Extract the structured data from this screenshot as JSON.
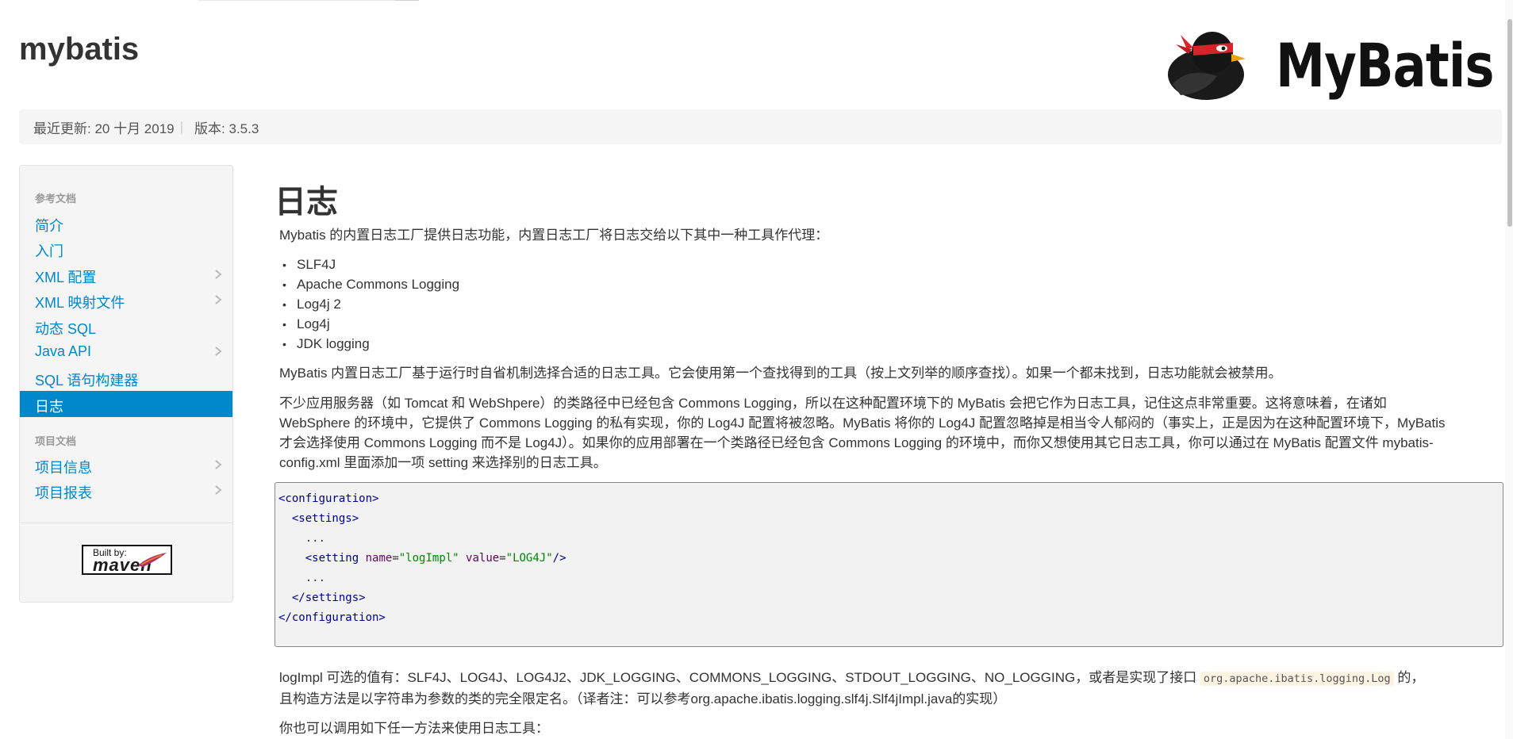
{
  "header": {
    "brand": "mybatis",
    "logo_alt": "MyBatis"
  },
  "breadcrumb": {
    "last_updated": "最近更新: 20 十月 2019",
    "separator": "|",
    "version": "版本: 3.5.3"
  },
  "sidebar": {
    "sections": [
      {
        "header": "参考文档",
        "items": [
          "简介",
          "入门",
          "XML 配置",
          "XML 映射文件",
          "动态 SQL",
          "Java API",
          "SQL 语句构建器",
          "日志"
        ]
      },
      {
        "header": "项目文档",
        "items": [
          "项目信息",
          "项目报表"
        ]
      }
    ],
    "active_item": "日志",
    "built_by": "Built by:",
    "maven": "maven"
  },
  "content": {
    "title": "日志",
    "intro": "Mybatis 的内置日志工厂提供日志功能，内置日志工厂将日志交给以下其中一种工具作代理：",
    "tools": [
      "SLF4J",
      "Apache Commons Logging",
      "Log4j 2",
      "Log4j",
      "JDK logging"
    ],
    "para1": "MyBatis 内置日志工厂基于运行时自省机制选择合适的日志工具。它会使用第一个查找得到的工具（按上文列举的顺序查找）。如果一个都未找到，日志功能就会被禁用。",
    "para2_lines": [
      "不少应用服务器（如 Tomcat 和 WebShpere）的类路径中已经包含 Commons Logging，所以在这种配置环境下的 MyBatis 会把它作为日志工具，记住这点非常重要。这将意味着，在诸如",
      "WebSphere 的环境中，它提供了 Commons Logging 的私有实现，你的 Log4J 配置将被忽略。MyBatis 将你的 Log4J 配置忽略掉是相当令人郁闷的（事实上，正是因为在这种配置环境下，MyBatis",
      "才会选择使用 Commons Logging 而不是 Log4J）。如果你的应用部署在一个类路径已经包含 Commons Logging 的环境中，而你又想使用其它日志工具，你可以通过在 MyBatis 配置文件 mybatis-",
      "config.xml 里面添加一项 setting 来选择别的日志工具。"
    ],
    "code": {
      "configuration_open": "<configuration>",
      "settings_open": "<settings>",
      "ellipsis": "...",
      "setting_tag_open": "<setting",
      "attr_name": "name",
      "attr_name_value": "\"logImpl\"",
      "attr_value": "value",
      "attr_value_value": "\"LOG4J\"",
      "setting_tag_close": "/>",
      "settings_close": "</settings>",
      "configuration_close": "</configuration>"
    },
    "para3_line1_before": "logImpl 可选的值有：SLF4J、LOG4J、LOG4J2、JDK_LOGGING、COMMONS_LOGGING、STDOUT_LOGGING、NO_LOGGING，或者是实现了接口 ",
    "para3_code": "org.apache.ibatis.logging.Log",
    "para3_line1_after": " 的，",
    "para3_line2": "且构造方法是以字符串为参数的类的完全限定名。（译者注：可以参考org.apache.ibatis.logging.slf4j.Slf4jImpl.java的实现）",
    "para4": "你也可以调用如下任一方法来使用日志工具："
  }
}
